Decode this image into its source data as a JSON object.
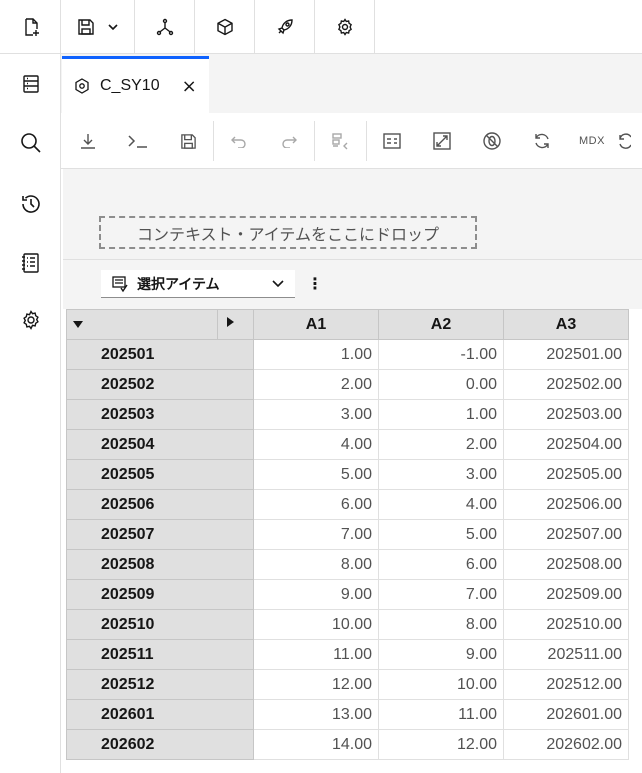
{
  "rail": {
    "icons": [
      "new-file-icon",
      "database-icon",
      "search-icon",
      "history-icon",
      "notes-list-icon",
      "settings-icon"
    ]
  },
  "topbar": {
    "icons": [
      "save-icon",
      "chevron-down-icon",
      "hierarchy-icon",
      "cube-icon",
      "rocket-icon",
      "gear-icon"
    ]
  },
  "tab": {
    "label": "C_SY10",
    "close": "×"
  },
  "actionbar": {
    "mdx_label": "MDX"
  },
  "dropzone": {
    "text": "コンテキスト・アイテムをここにドロップ"
  },
  "selection": {
    "label": "選択アイテム",
    "more": "⋮"
  },
  "grid": {
    "columns": [
      "A1",
      "A2",
      "A3"
    ],
    "rows": [
      {
        "label": "202501",
        "values": [
          "1.00",
          "-1.00",
          "202501.00"
        ]
      },
      {
        "label": "202502",
        "values": [
          "2.00",
          "0.00",
          "202502.00"
        ]
      },
      {
        "label": "202503",
        "values": [
          "3.00",
          "1.00",
          "202503.00"
        ]
      },
      {
        "label": "202504",
        "values": [
          "4.00",
          "2.00",
          "202504.00"
        ]
      },
      {
        "label": "202505",
        "values": [
          "5.00",
          "3.00",
          "202505.00"
        ]
      },
      {
        "label": "202506",
        "values": [
          "6.00",
          "4.00",
          "202506.00"
        ]
      },
      {
        "label": "202507",
        "values": [
          "7.00",
          "5.00",
          "202507.00"
        ]
      },
      {
        "label": "202508",
        "values": [
          "8.00",
          "6.00",
          "202508.00"
        ]
      },
      {
        "label": "202509",
        "values": [
          "9.00",
          "7.00",
          "202509.00"
        ]
      },
      {
        "label": "202510",
        "values": [
          "10.00",
          "8.00",
          "202510.00"
        ]
      },
      {
        "label": "202511",
        "values": [
          "11.00",
          "9.00",
          "202511.00"
        ]
      },
      {
        "label": "202512",
        "values": [
          "12.00",
          "10.00",
          "202512.00"
        ]
      },
      {
        "label": "202601",
        "values": [
          "13.00",
          "11.00",
          "202601.00"
        ]
      },
      {
        "label": "202602",
        "values": [
          "14.00",
          "12.00",
          "202602.00"
        ]
      }
    ]
  },
  "colors": {
    "accent": "#0f62fe",
    "header_bg": "#e0e0e0",
    "panel_bg": "#f4f4f4"
  }
}
